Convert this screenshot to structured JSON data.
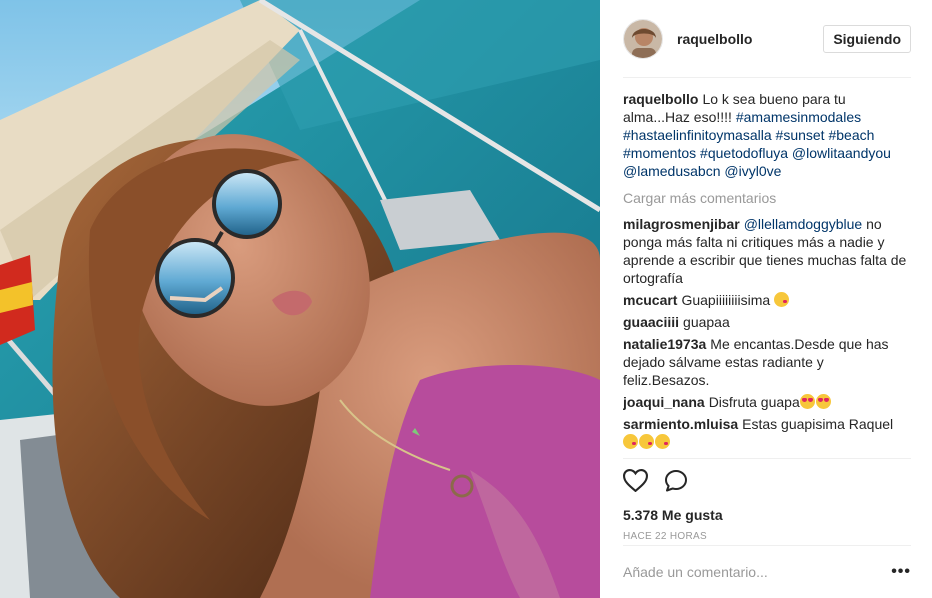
{
  "header": {
    "username": "raquelbollo",
    "follow_label": "Siguiendo"
  },
  "caption": {
    "username": "raquelbollo",
    "text": "Lo k sea bueno para tu alma...Haz eso!!!! ",
    "tags": [
      "#amamesinmodales",
      "#hastaelinfinitoymasalla",
      "#sunset",
      "#beach",
      "#momentos",
      "#quetodofluya",
      "@lowlitaandyou",
      "@lamedusabcn",
      "@ivyl0ve"
    ]
  },
  "load_more": "Cargar más comentarios",
  "comments": [
    {
      "username": "milagrosmenjibar",
      "mention": "@llellamdoggyblue",
      "text": " no ponga más falta ni critiques más a nadie y aprende a escribir que tienes muchas falta de ortografía",
      "emoji": []
    },
    {
      "username": "mcucart",
      "mention": "",
      "text": "Guapiiiiiiiisima ",
      "emoji": [
        "kiss"
      ]
    },
    {
      "username": "guaaciiii",
      "mention": "",
      "text": "guapaa",
      "emoji": []
    },
    {
      "username": "natalie1973a",
      "mention": "",
      "text": "Me encantas.Desde que has dejado sálvame estas radiante y feliz.Besazos.",
      "emoji": []
    },
    {
      "username": "joaqui_nana",
      "mention": "",
      "text": "Disfruta guapa",
      "emoji": [
        "heart-eyes",
        "heart-eyes"
      ]
    },
    {
      "username": "sarmiento.mluisa",
      "mention": "",
      "text": "Estas guapisima Raquel ",
      "emoji": [
        "kiss",
        "kiss",
        "kiss"
      ]
    }
  ],
  "likes": "5.378 Me gusta",
  "timestamp": "HACE 22 HORAS",
  "add_comment": {
    "placeholder": "Añade un comentario...",
    "more": "•••"
  },
  "icons": {
    "like": "heart-outline-icon",
    "comment": "speech-bubble-icon",
    "more": "more-options-icon"
  }
}
